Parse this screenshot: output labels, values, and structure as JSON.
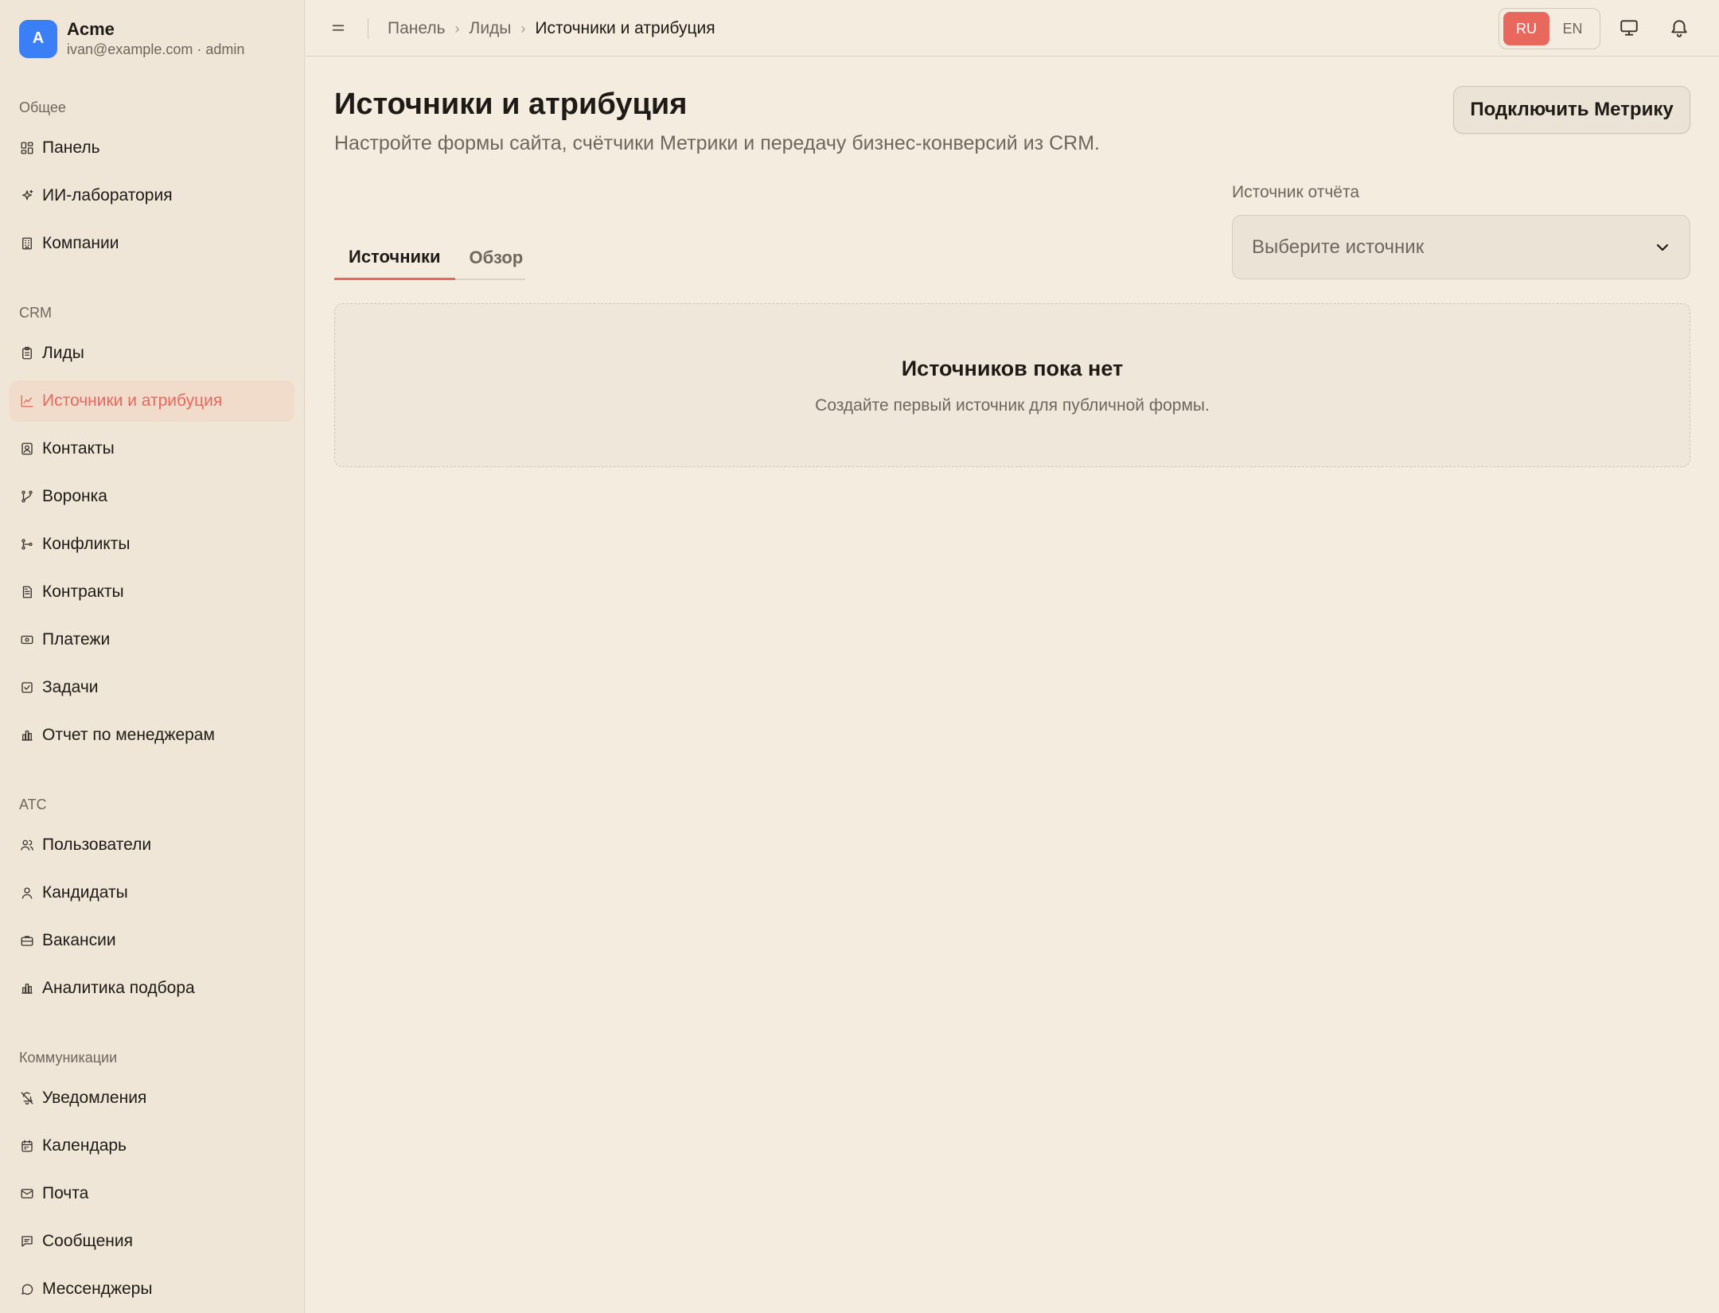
{
  "brand": {
    "initial": "A",
    "name": "Acme",
    "user": "ivan@example.com · admin"
  },
  "sidebar": {
    "sections": [
      {
        "title": "Общее",
        "items": [
          {
            "label": "Панель",
            "icon": "dashboard-icon"
          },
          {
            "label": "ИИ-лаборатория",
            "icon": "sparkles-icon"
          },
          {
            "label": "Компании",
            "icon": "building-icon"
          }
        ]
      },
      {
        "title": "CRM",
        "items": [
          {
            "label": "Лиды",
            "icon": "clipboard-icon"
          },
          {
            "label": "Источники и атрибуция",
            "icon": "chart-line-icon",
            "active": true
          },
          {
            "label": "Контакты",
            "icon": "contact-icon"
          },
          {
            "label": "Воронка",
            "icon": "funnel-icon"
          },
          {
            "label": "Конфликты",
            "icon": "git-branch-icon"
          },
          {
            "label": "Контракты",
            "icon": "document-icon"
          },
          {
            "label": "Платежи",
            "icon": "banknote-icon"
          },
          {
            "label": "Задачи",
            "icon": "checkbox-icon"
          },
          {
            "label": "Отчет по менеджерам",
            "icon": "bar-chart-icon"
          }
        ]
      },
      {
        "title": "ATC",
        "items": [
          {
            "label": "Пользователи",
            "icon": "users-icon"
          },
          {
            "label": "Кандидаты",
            "icon": "user-icon"
          },
          {
            "label": "Вакансии",
            "icon": "briefcase-icon"
          },
          {
            "label": "Аналитика подбора",
            "icon": "bar-chart-icon"
          }
        ]
      },
      {
        "title": "Коммуникации",
        "items": [
          {
            "label": "Уведомления",
            "icon": "bell-off-icon"
          },
          {
            "label": "Календарь",
            "icon": "calendar-icon"
          },
          {
            "label": "Почта",
            "icon": "mail-icon"
          },
          {
            "label": "Сообщения",
            "icon": "message-square-icon"
          },
          {
            "label": "Мессенджеры",
            "icon": "message-circle-icon"
          }
        ]
      }
    ]
  },
  "topbar": {
    "breadcrumb": [
      "Панель",
      "Лиды",
      "Источники и атрибуция"
    ],
    "languages": [
      {
        "code": "RU",
        "active": true
      },
      {
        "code": "EN",
        "active": false
      }
    ],
    "icons": [
      "menu-icon",
      "monitor-icon",
      "bell-icon"
    ]
  },
  "main": {
    "title": "Источники и атрибуция",
    "subtitle": "Настройте формы сайта, счётчики Метрики и передачу бизнес-конверсий из CRM.",
    "connect_button": "Подключить Метрику",
    "report_source": {
      "label": "Источник отчёта",
      "placeholder": "Выберите источник"
    },
    "tabs": [
      {
        "label": "Источники",
        "active": true
      },
      {
        "label": "Обзор",
        "active": false
      }
    ],
    "empty": {
      "title": "Источников пока нет",
      "subtitle": "Создайте первый источник для публичной формы."
    }
  },
  "colors": {
    "accent": "#e8685e",
    "brand_avatar": "#3b7ff6",
    "background": "#f3ecdf",
    "sidebar": "#efe6d8"
  }
}
